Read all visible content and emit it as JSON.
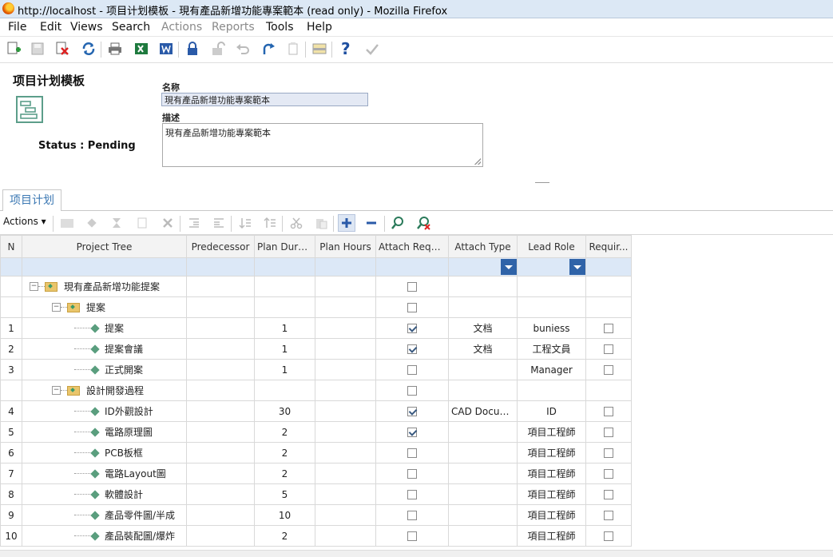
{
  "window": {
    "title": "http://localhost - 项目计划模板 - 現有產品新增功能專案範本 (read only) - Mozilla Firefox"
  },
  "menu": [
    {
      "label": "File",
      "enabled": true
    },
    {
      "label": "Edit",
      "enabled": true
    },
    {
      "label": "Views",
      "enabled": true
    },
    {
      "label": "Search",
      "enabled": true
    },
    {
      "label": "Actions",
      "enabled": false
    },
    {
      "label": "Reports",
      "enabled": false
    },
    {
      "label": "Tools",
      "enabled": true
    },
    {
      "label": "Help",
      "enabled": true
    }
  ],
  "toolbar_icons": [
    "new-icon",
    "save-icon",
    "delete-icon",
    "refresh-icon",
    "print-icon",
    "excel-icon",
    "word-icon",
    "lock-icon",
    "unlock-icon",
    "undo-icon",
    "redo-icon",
    "copy-icon",
    "layout-icon",
    "help-icon",
    "done-icon"
  ],
  "form": {
    "title": "项目计划模板",
    "status": "Status : Pending",
    "name_label": "名称",
    "name_value": "現有產品新增功能專案範本",
    "desc_label": "描述",
    "desc_value": "現有產品新增功能專案範本"
  },
  "tabs": [
    {
      "label": "项目计划",
      "active": true
    }
  ],
  "grid_toolbar": {
    "actions_label": "Actions"
  },
  "grid": {
    "headers": [
      "N",
      "Project Tree",
      "Predecessor",
      "Plan Dura...",
      "Plan Hours",
      "Attach Requi...",
      "Attach Type",
      "Lead Role",
      "Requir..."
    ],
    "rows": [
      {
        "n": "",
        "level": 0,
        "kind": "folder",
        "label": "現有產品新增功能提案",
        "pred": "",
        "dur": "",
        "hours": "",
        "attach_req": false,
        "attach_type": "",
        "lead": "",
        "req": null
      },
      {
        "n": "",
        "level": 1,
        "kind": "folder",
        "label": "提案",
        "pred": "",
        "dur": "",
        "hours": "",
        "attach_req": false,
        "attach_type": "",
        "lead": "",
        "req": null
      },
      {
        "n": "1",
        "level": 2,
        "kind": "task",
        "label": "提案",
        "pred": "",
        "dur": "1",
        "hours": "",
        "attach_req": true,
        "attach_type": "文档",
        "lead": "buniess",
        "req": false
      },
      {
        "n": "2",
        "level": 2,
        "kind": "task",
        "label": "提案會議",
        "pred": "",
        "dur": "1",
        "hours": "",
        "attach_req": true,
        "attach_type": "文档",
        "lead": "工程文員",
        "req": false
      },
      {
        "n": "3",
        "level": 2,
        "kind": "task",
        "label": "正式開案",
        "pred": "",
        "dur": "1",
        "hours": "",
        "attach_req": false,
        "attach_type": "",
        "lead": "Manager",
        "req": false
      },
      {
        "n": "",
        "level": 1,
        "kind": "folder",
        "label": "設計開發過程",
        "pred": "",
        "dur": "",
        "hours": "",
        "attach_req": false,
        "attach_type": "",
        "lead": "",
        "req": null
      },
      {
        "n": "4",
        "level": 2,
        "kind": "task",
        "label": "ID外觀設計",
        "pred": "",
        "dur": "30",
        "hours": "",
        "attach_req": true,
        "attach_type": "CAD Docum...",
        "lead": "ID",
        "req": false
      },
      {
        "n": "5",
        "level": 2,
        "kind": "task",
        "label": "電路原理圖",
        "pred": "",
        "dur": "2",
        "hours": "",
        "attach_req": true,
        "attach_type": "",
        "lead": "項目工程師",
        "req": false
      },
      {
        "n": "6",
        "level": 2,
        "kind": "task",
        "label": "PCB板框",
        "pred": "",
        "dur": "2",
        "hours": "",
        "attach_req": false,
        "attach_type": "",
        "lead": "項目工程師",
        "req": false
      },
      {
        "n": "7",
        "level": 2,
        "kind": "task",
        "label": "電路Layout圖",
        "pred": "",
        "dur": "2",
        "hours": "",
        "attach_req": false,
        "attach_type": "",
        "lead": "項目工程師",
        "req": false
      },
      {
        "n": "8",
        "level": 2,
        "kind": "task",
        "label": "軟體設計",
        "pred": "",
        "dur": "5",
        "hours": "",
        "attach_req": false,
        "attach_type": "",
        "lead": "項目工程師",
        "req": false
      },
      {
        "n": "9",
        "level": 2,
        "kind": "task",
        "label": "產品零件圖/半成",
        "pred": "",
        "dur": "10",
        "hours": "",
        "attach_req": false,
        "attach_type": "",
        "lead": "項目工程師",
        "req": false
      },
      {
        "n": "10",
        "level": 2,
        "kind": "task",
        "label": "產品裝配圖/爆炸",
        "pred": "",
        "dur": "2",
        "hours": "",
        "attach_req": false,
        "attach_type": "",
        "lead": "項目工程師",
        "req": false
      }
    ]
  }
}
